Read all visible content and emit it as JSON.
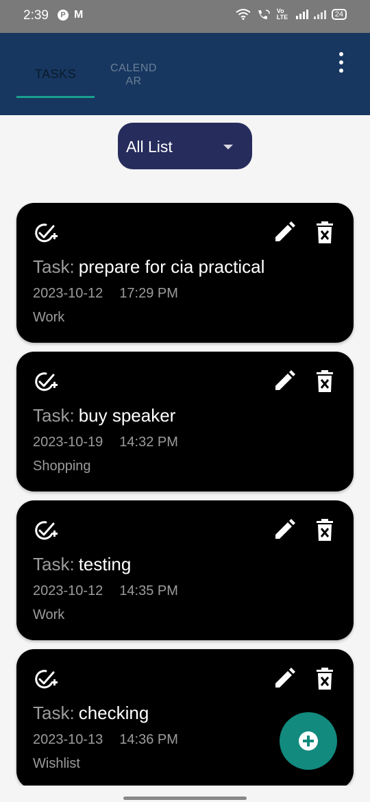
{
  "status_bar": {
    "time": "2:39",
    "left_icons": [
      "p-badge-icon",
      "m-badge-icon"
    ],
    "right_icons": [
      "wifi-icon",
      "wifi-calling-icon",
      "volte-icon",
      "signal-icon",
      "signal-icon"
    ],
    "network_label": "Vo LTE",
    "battery": "24"
  },
  "header": {
    "tabs": [
      {
        "label": "TASKS",
        "selected": true
      },
      {
        "label": "CALENDAR",
        "selected": false
      }
    ],
    "menu_icon": "more-vert-icon",
    "accent_color": "#1aa08e",
    "background": "#173760"
  },
  "filter": {
    "selected": "All List",
    "icon": "dropdown-arrow-icon"
  },
  "tasks": [
    {
      "prefix": "Task:",
      "name": "prepare for cia practical",
      "date": "2023-10-12",
      "time": "17:29 PM",
      "category": "Work"
    },
    {
      "prefix": "Task:",
      "name": "buy speaker",
      "date": "2023-10-19",
      "time": "14:32 PM",
      "category": "Shopping"
    },
    {
      "prefix": "Task:",
      "name": "testing",
      "date": "2023-10-12",
      "time": "14:35 PM",
      "category": "Work"
    },
    {
      "prefix": "Task:",
      "name": "checking",
      "date": "2023-10-13",
      "time": "14:36 PM",
      "category": "Wishlist"
    }
  ],
  "card_icons": [
    "mark-complete-icon",
    "edit-icon",
    "delete-icon"
  ],
  "fab": {
    "icon": "add-circle-icon",
    "color": "#128a7e"
  }
}
